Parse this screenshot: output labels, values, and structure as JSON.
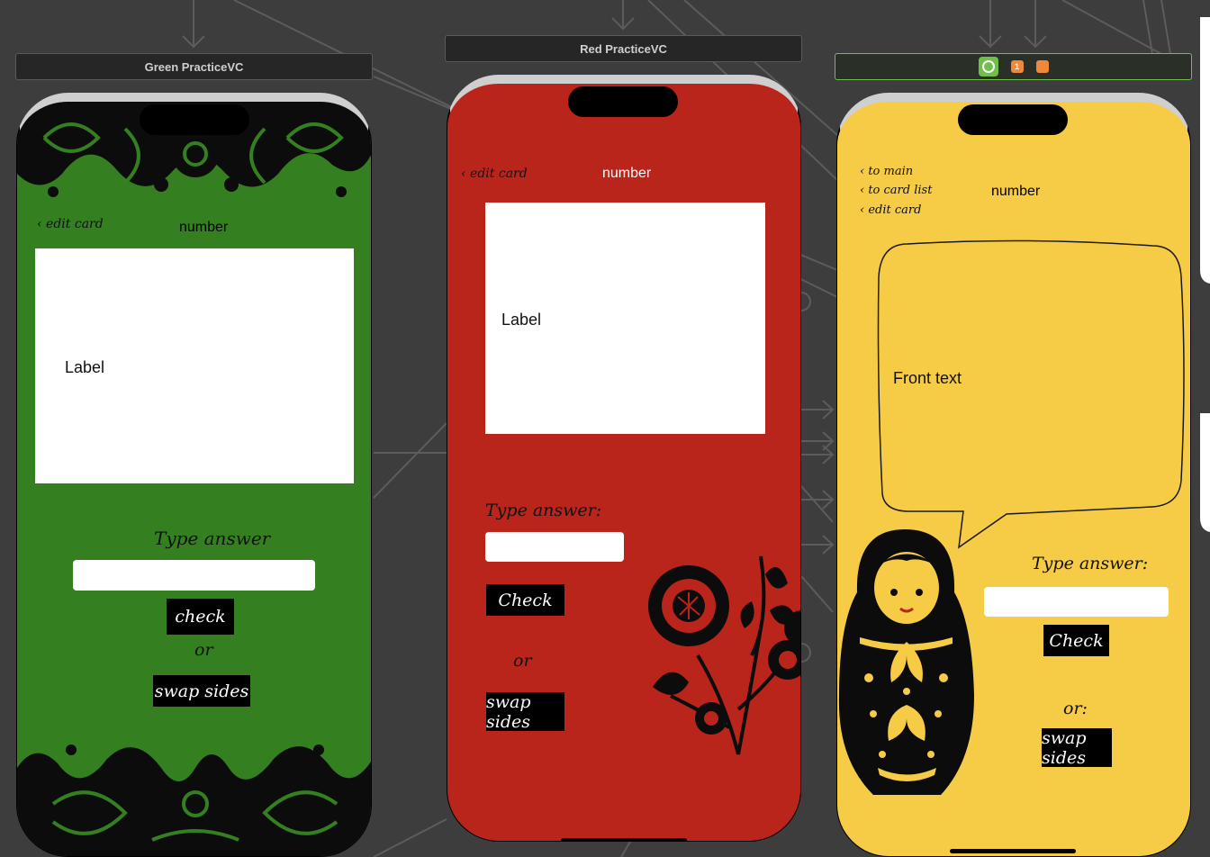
{
  "canvas": {
    "background": "#3d3d3d",
    "line_color": "#5c5c5c"
  },
  "scenes": [
    {
      "title": "Green PracticeVC",
      "bg": "#347f1f",
      "nav": {
        "back": "‹ edit card",
        "title": "number"
      },
      "label": "Label",
      "prompt": "Type answer",
      "check": "check",
      "or": "or",
      "swap": "swap sides"
    },
    {
      "title": "Red PracticeVC",
      "bg": "#b9241b",
      "nav": {
        "back": "‹ edit card",
        "title": "number"
      },
      "label": "Label",
      "prompt": "Type answer:",
      "check": "Check",
      "or": "or",
      "swap": "swap sides"
    },
    {
      "title_icons": [
        "view-controller-icon",
        "first-responder-icon",
        "exit-icon"
      ],
      "first_responder_glyph": "1",
      "bg": "#f6cb45",
      "nav": {
        "back": [
          "‹ to main",
          "‹ to card list",
          "‹ edit card"
        ],
        "title": "number"
      },
      "front_text": "Front text",
      "prompt": "Type answer:",
      "check": "Check",
      "or": "or:",
      "swap": "swap sides"
    }
  ]
}
